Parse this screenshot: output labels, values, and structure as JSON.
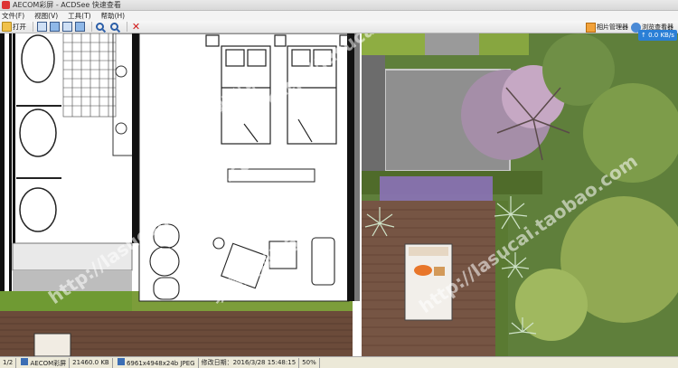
{
  "window": {
    "title": "AECOM彩屏 - ACDSee 快速查看"
  },
  "menu": {
    "items": [
      "文件(F)",
      "视图(V)",
      "工具(T)",
      "帮助(H)"
    ]
  },
  "toolbar": {
    "open_label": "打开",
    "manager_label": "相片管理器",
    "viewer_label": "浏览查看器"
  },
  "network": {
    "speed": "↑ 0.0 KB/s"
  },
  "watermark": {
    "site": "http://lasucai.taobao.com",
    "shop": "筑景景观淘宝店"
  },
  "status": {
    "page": "1/2",
    "filename": "AECOM彩屏",
    "filesize": "21460.0 KB",
    "image_info": "6961x4948x24b JPEG",
    "modified": "修改日期：2016/3/28 15:48:15",
    "zoom": "50%"
  },
  "colors": {
    "accent": "#2a7fd6",
    "deck": "#6b4b3a",
    "lawn": "#6f9a33",
    "paving": "#8f8f8f"
  }
}
